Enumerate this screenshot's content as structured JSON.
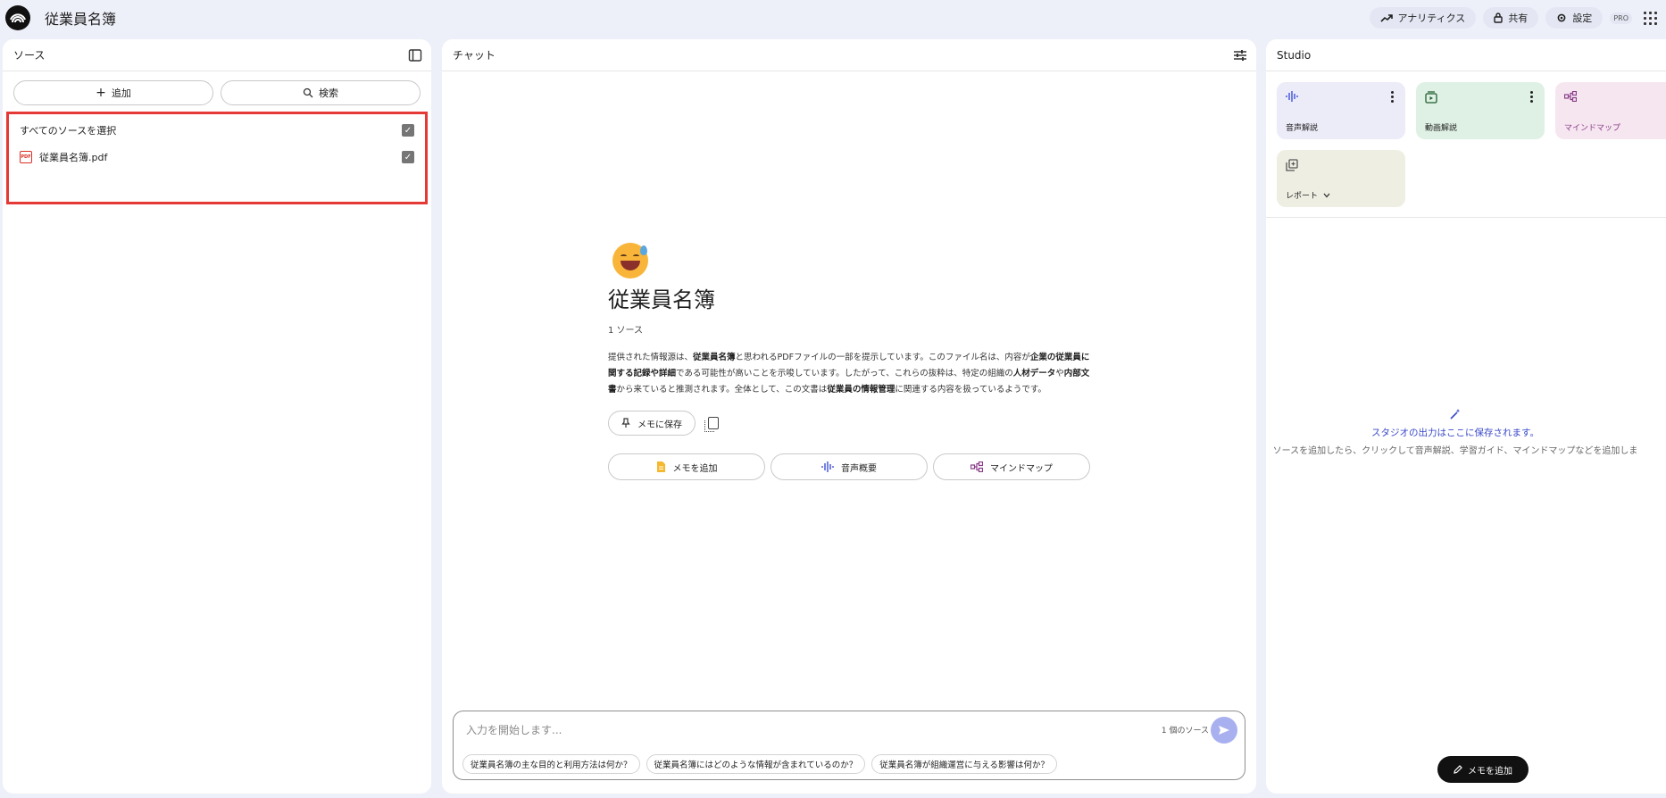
{
  "app": {
    "title": "従業員名簿"
  },
  "topbar": {
    "analytics_label": "アナリティクス",
    "share_label": "共有",
    "settings_label": "設定",
    "pro_badge": "PRO"
  },
  "sources": {
    "header": "ソース",
    "add_label": "追加",
    "search_label": "検索",
    "select_all_label": "すべてのソースを選択",
    "items": [
      {
        "name": "従業員名簿.pdf",
        "icon": "pdf-icon",
        "checked": true
      }
    ]
  },
  "chat": {
    "header": "チャット",
    "notebook_title": "従業員名簿",
    "source_count": "1 ソース",
    "summary_parts": [
      "提供された情報源は、",
      "従業員名簿",
      "と思われるPDFファイルの一部を提示しています。このファイル名は、内容が",
      "企業の従業員に関する記録や詳細",
      "である可能性が高いことを示唆しています。したがって、これらの抜粋は、特定の組織の",
      "人材データ",
      "や",
      "内部文書",
      "から来ていると推測されます。全体として、この文書は",
      "従業員の情報管理",
      "に関連する内容を扱っているようです。"
    ],
    "save_to_memo_label": "メモに保存",
    "actions": [
      {
        "label": "メモを追加",
        "icon": "note-icon"
      },
      {
        "label": "音声概要",
        "icon": "audio-wave-icon"
      },
      {
        "label": "マインドマップ",
        "icon": "mindmap-icon"
      }
    ],
    "input": {
      "placeholder": "入力を開始します...",
      "source_count": "1 個のソース"
    },
    "suggestions": [
      "従業員名簿の主な目的と利用方法は何か？",
      "従業員名簿にはどのような情報が含まれているのか？",
      "従業員名簿が組織運営に与える影響は何か？"
    ]
  },
  "studio": {
    "header": "Studio",
    "tiles": [
      {
        "label": "音声解説",
        "icon": "audio-wave-icon",
        "color": "#ecebf8"
      },
      {
        "label": "動画解説",
        "icon": "video-icon",
        "color": "#dff1e4"
      },
      {
        "label": "マインドマップ",
        "icon": "mindmap-icon",
        "color": "#f6e6f0"
      },
      {
        "label": "レポート",
        "icon": "report-icon",
        "color": "#efeee3"
      }
    ],
    "empty_title": "スタジオの出力はここに保存されます。",
    "empty_desc": "ソースを追加したら、クリックして音声解説、学習ガイド、マインドマップなどを追加しま",
    "add_memo_label": "メモを追加"
  }
}
